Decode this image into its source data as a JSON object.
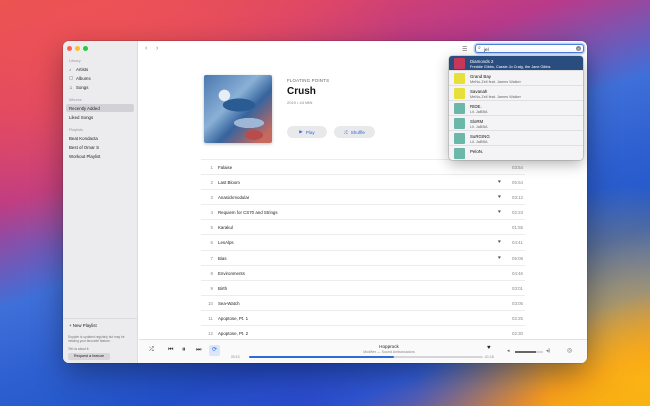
{
  "sidebar": {
    "library_title": "Library",
    "library": [
      {
        "label": "Artists",
        "icon": "mic-icon"
      },
      {
        "label": "Albums",
        "icon": "album-icon"
      },
      {
        "label": "Songs",
        "icon": "note-icon"
      }
    ],
    "albums_title": "Albums",
    "albums": [
      {
        "label": "Recently Added",
        "selected": true
      },
      {
        "label": "Liked Songs",
        "selected": false
      }
    ],
    "playlists_title": "Playlists",
    "playlists": [
      {
        "label": "Beat Kondacta"
      },
      {
        "label": "Best of Omar S"
      },
      {
        "label": "Workout Playlist"
      }
    ],
    "new_playlist": "+ New Playlist",
    "note": "Doppler is updated regularly but may be missing your favourite feature.",
    "note2": "Tell us about it:",
    "request_button": "Request a feature"
  },
  "header": {
    "back": "‹",
    "forward": "›",
    "search_query": "jel"
  },
  "album": {
    "artist": "FLOATING POINTS",
    "title": "Crush",
    "meta": "2019 • 44 MIN",
    "play_label": "Play",
    "shuffle_label": "Shuffle"
  },
  "tracks": [
    {
      "num": "1",
      "title": "Falaise",
      "liked": false,
      "duration": "03:54"
    },
    {
      "num": "2",
      "title": "Last Bloom",
      "liked": true,
      "duration": "05:54"
    },
    {
      "num": "3",
      "title": "Anasickmodular",
      "liked": true,
      "duration": "03:12"
    },
    {
      "num": "4",
      "title": "Requiem for CS70 and Strings",
      "liked": true,
      "duration": "02:23"
    },
    {
      "num": "5",
      "title": "Karakul",
      "liked": false,
      "duration": "01:55"
    },
    {
      "num": "6",
      "title": "LesAlps",
      "liked": true,
      "duration": "04:41"
    },
    {
      "num": "7",
      "title": "Bias",
      "liked": true,
      "duration": "05:08"
    },
    {
      "num": "8",
      "title": "Environments",
      "liked": false,
      "duration": "04:46"
    },
    {
      "num": "9",
      "title": "Birth",
      "liked": false,
      "duration": "03:01"
    },
    {
      "num": "10",
      "title": "Sea-Watch",
      "liked": false,
      "duration": "03:05"
    },
    {
      "num": "11",
      "title": "Apoptose, Pt. 1",
      "liked": false,
      "duration": "02:25"
    },
    {
      "num": "12",
      "title": "Apoptose, Pt. 2",
      "liked": false,
      "duration": "02:30"
    }
  ],
  "player": {
    "title": "Hopprock",
    "subtitle": "Modifier — Sound Ambassadors",
    "elapsed": "00:13",
    "remaining": "-01:18",
    "progress": 0.62,
    "volume": 0.75,
    "accent": "#2d6bd8"
  },
  "search_results": [
    {
      "title": "Diamonds 2",
      "subtitle": "Freddie Gibbs, Cassie Jo Craig, the Jane Gibbs",
      "thumb": "#c8365a",
      "selected": true
    },
    {
      "title": "Grand Bay",
      "subtitle": "MeNo-Zell feat. James Walker",
      "thumb": "#e8e03a",
      "selected": false
    },
    {
      "title": "Savanah",
      "subtitle": "MeNo-Zell feat. James Walker",
      "thumb": "#e8e03a",
      "selected": false
    },
    {
      "title": "RIDE.",
      "subtitle": "Lil. JaBBA",
      "thumb": "#6bb8a8",
      "selected": false
    },
    {
      "title": "SloRM",
      "subtitle": "Lil. JaBBA",
      "thumb": "#6bb8a8",
      "selected": false
    },
    {
      "title": "SuRGING",
      "subtitle": "Lil. JaBBA",
      "thumb": "#6bb8a8",
      "selected": false
    },
    {
      "title": "PeloN.",
      "subtitle": "",
      "thumb": "#6bb8a8",
      "selected": false
    }
  ]
}
